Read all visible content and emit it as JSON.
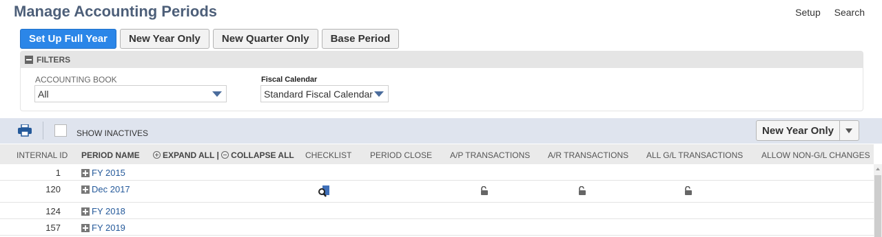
{
  "page": {
    "title": "Manage Accounting Periods",
    "links": [
      "Setup",
      "Search"
    ]
  },
  "buttons": [
    "Set Up Full Year",
    "New Year Only",
    "New Quarter Only",
    "Base Period"
  ],
  "filters": {
    "header": "FILTERS",
    "accounting_book_label": "ACCOUNTING BOOK",
    "accounting_book_value": "All",
    "fiscal_calendar_label": "Fiscal Calendar",
    "fiscal_calendar_value": "Standard Fiscal Calendar"
  },
  "list_toolbar": {
    "show_inactives_label": "SHOW INACTIVES",
    "new_year_button": "New Year Only"
  },
  "table": {
    "headers": {
      "internal_id": "INTERNAL ID",
      "period_name": "PERIOD NAME",
      "expand_all": "EXPAND ALL",
      "separator": "|",
      "collapse_all": "COLLAPSE ALL",
      "checklist": "CHECKLIST",
      "period_close": "PERIOD CLOSE",
      "ap": "A/P TRANSACTIONS",
      "ar": "A/R TRANSACTIONS",
      "gl": "ALL G/L TRANSACTIONS",
      "non_gl": "ALLOW NON-G/L CHANGES"
    },
    "rows": [
      {
        "id": "1",
        "name": "FY 2015"
      },
      {
        "id": "120",
        "name": "Dec 2017"
      },
      {
        "id": "124",
        "name": "FY 2018"
      },
      {
        "id": "157",
        "name": "FY 2019"
      }
    ]
  },
  "icons": {
    "print": "printer-icon",
    "checklist": "magnifier-document-icon",
    "lock": "unlocked-padlock-icon"
  },
  "colors": {
    "primary_button": "#2b86e8",
    "title": "#4d5f79",
    "link": "#24599a",
    "toolbar_bg": "#dfe4ee"
  }
}
